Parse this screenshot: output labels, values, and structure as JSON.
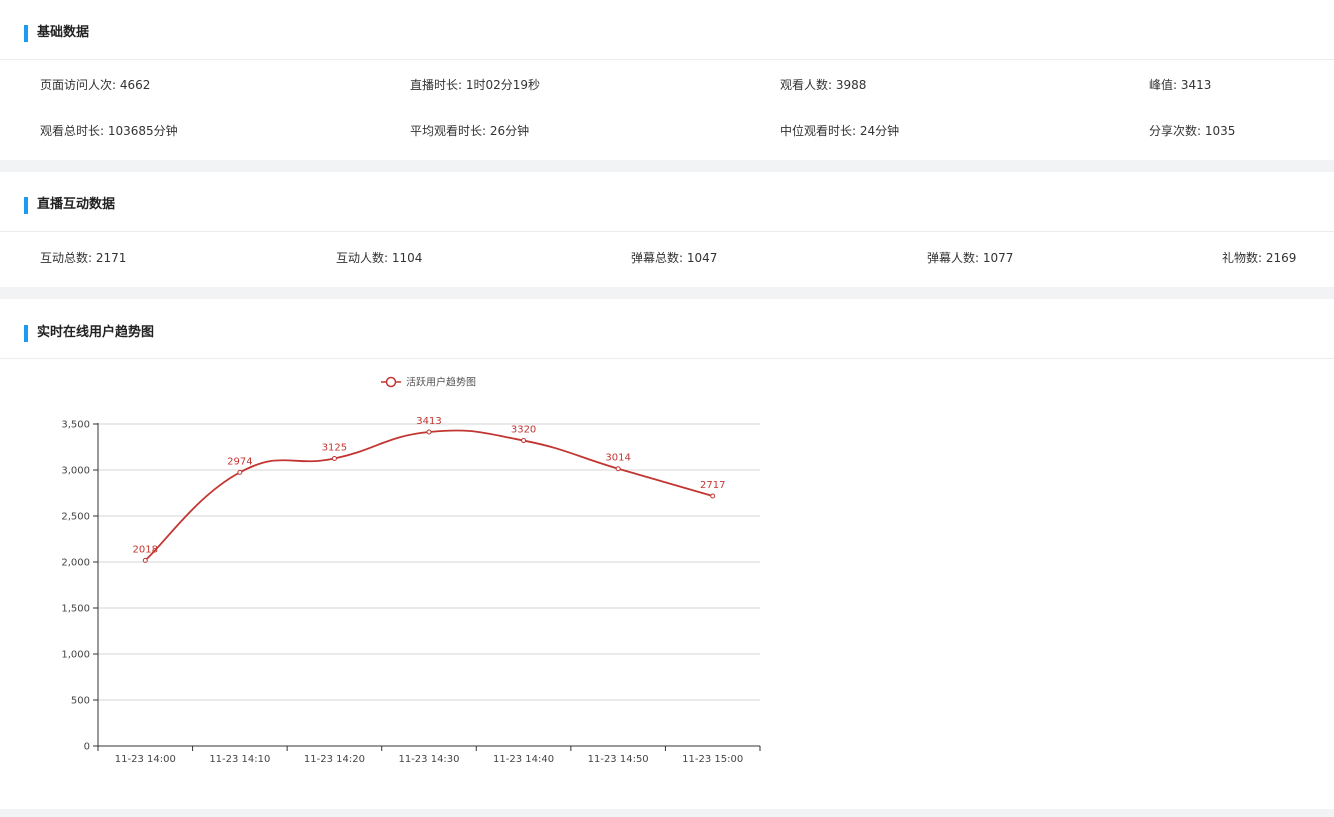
{
  "basic": {
    "title": "基础数据",
    "stats": [
      {
        "label": "页面访问人次: 4662"
      },
      {
        "label": "直播时长: 1时02分19秒"
      },
      {
        "label": "观看人数: 3988"
      },
      {
        "label": "峰值: 3413"
      },
      {
        "label": "观看总时长: 103685分钟"
      },
      {
        "label": "平均观看时长: 26分钟"
      },
      {
        "label": "中位观看时长: 24分钟"
      },
      {
        "label": "分享次数: 1035"
      }
    ]
  },
  "interaction": {
    "title": "直播互动数据",
    "stats": [
      {
        "label": "互动总数: 2171"
      },
      {
        "label": "互动人数: 1104"
      },
      {
        "label": "弹幕总数: 1047"
      },
      {
        "label": "弹幕人数: 1077"
      },
      {
        "label": "礼物数: 2169"
      }
    ]
  },
  "trend": {
    "title": "实时在线用户趋势图"
  },
  "chart_data": {
    "type": "line",
    "categories": [
      "11-23 14:00",
      "11-23 14:10",
      "11-23 14:20",
      "11-23 14:30",
      "11-23 14:40",
      "11-23 14:50",
      "11-23 15:00"
    ],
    "series": [
      {
        "name": "活跃用户趋势图",
        "values": [
          2018,
          2974,
          3125,
          3413,
          3320,
          3014,
          2717
        ],
        "color": "#c23531"
      }
    ],
    "ylim": [
      0,
      3500
    ],
    "yticks": [
      0,
      500,
      1000,
      1500,
      2000,
      2500,
      3000,
      3500
    ],
    "ytick_labels": [
      "0",
      "500",
      "1,000",
      "1,500",
      "2,000",
      "2,500",
      "3,000",
      "3,500"
    ],
    "grid": true,
    "legend": "top-center",
    "data_labels": true
  }
}
